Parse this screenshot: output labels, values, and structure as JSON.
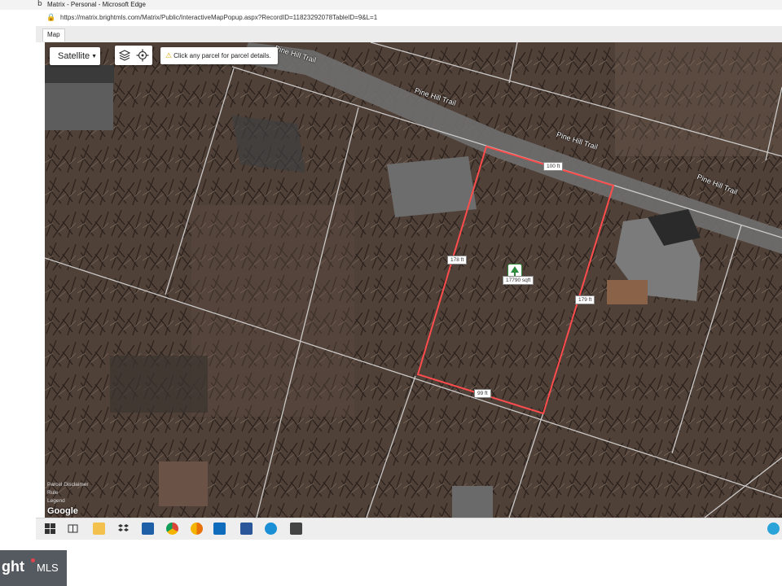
{
  "window": {
    "title": "Matrix - Personal - Microsoft Edge",
    "logo_text": "b"
  },
  "address_bar": {
    "url": "https://matrix.brightmls.com/Matrix/Public/InteractiveMapPopup.aspx?RecordID=11823292078TableID=9&L=1"
  },
  "tabs": [
    {
      "label": "Map",
      "active": true
    }
  ],
  "map": {
    "map_type_button": "Satellite",
    "hint": "Click any parcel for parcel details.",
    "road_labels": [
      "Pine Hill Trail",
      "Pine Hill Trail",
      "Pine Hill Trail",
      "Pine Hill Trail"
    ],
    "dimensions": {
      "north": "100 ft",
      "west": "178 ft",
      "east": "179 ft",
      "south": "99 ft"
    },
    "parcel_area": "17790 sqft",
    "attribution": "Google",
    "bottom_links": [
      "Parcel Disclaimer",
      "Rule",
      "Legend"
    ],
    "colors": {
      "parcel_outline": "#ff4d4d",
      "parcel_lines": "#d8d8d8",
      "road": "#6f6f6f"
    }
  },
  "taskbar": {
    "icons": [
      "windows-start-icon",
      "task-view-icon",
      "file-explorer-icon",
      "dropbox-icon",
      "lightning-app-icon",
      "chrome-icon",
      "chrome-canary-icon",
      "outlook-icon",
      "word-icon",
      "edge-icon",
      "store-icon"
    ]
  },
  "watermark": {
    "text_a": "ght",
    "text_b": "MLS"
  }
}
